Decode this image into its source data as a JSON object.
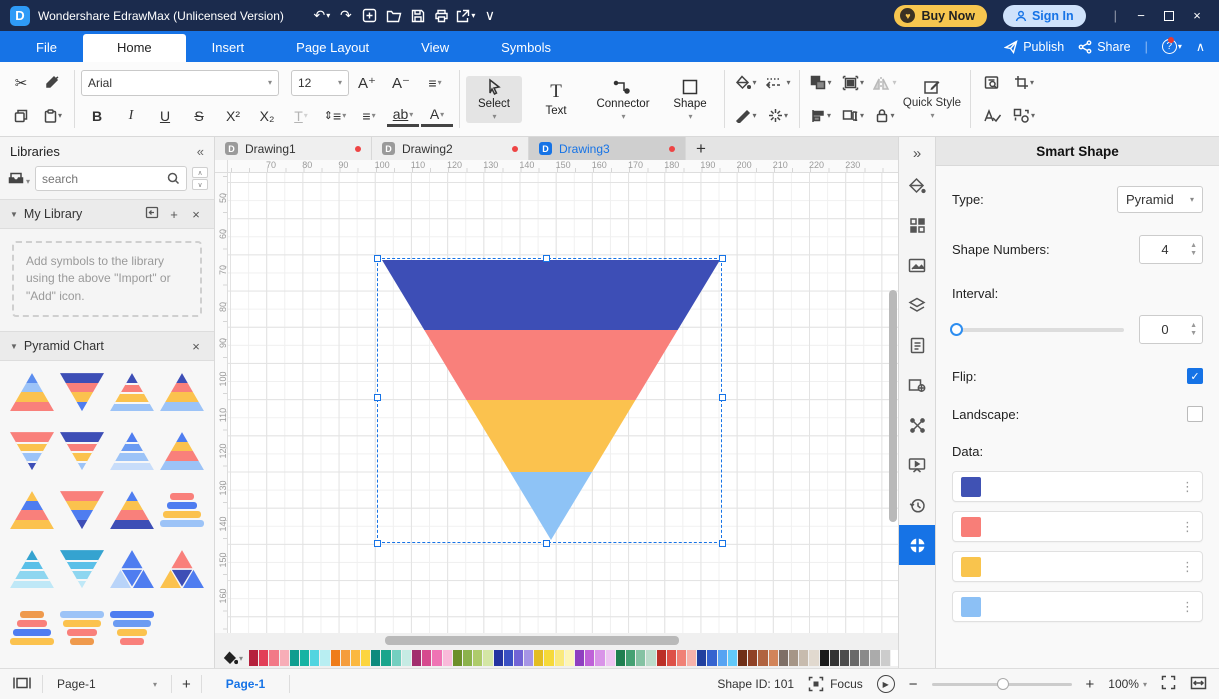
{
  "titlebar": {
    "app_title": "Wondershare EdrawMax (Unlicensed Version)",
    "buy_now": "Buy Now",
    "sign_in": "Sign In"
  },
  "menubar": {
    "items": [
      "File",
      "Home",
      "Insert",
      "Page Layout",
      "View",
      "Symbols"
    ],
    "active": "Home",
    "publish": "Publish",
    "share": "Share"
  },
  "ribbon": {
    "font_family": "Arial",
    "font_size": "12",
    "bold": "B",
    "italic": "I",
    "underline": "U",
    "strike": "S",
    "superscript": "X²",
    "subscript": "X₂",
    "text_style": "T",
    "highlight": "ab",
    "font_color": "A",
    "font_larger": "A⁺",
    "font_smaller": "A⁻",
    "select_label": "Select",
    "text_label": "Text",
    "connector_label": "Connector",
    "shape_label": "Shape",
    "quick_style_label": "Quick Style"
  },
  "left_panel": {
    "title": "Libraries",
    "search_placeholder": "search",
    "my_library": "My Library",
    "hint": "Add symbols to the library using the above \"Import\" or \"Add\" icon.",
    "pyramid_chart": "Pyramid Chart",
    "thumbs": [
      {
        "type": "u",
        "colors": [
          "#5b8def",
          "#9cc3f7",
          "#fbc24e",
          "#f9807b"
        ]
      },
      {
        "type": "d",
        "colors": [
          "#3d4eb6",
          "#f9807b",
          "#fbc24e",
          "#4f7df0"
        ]
      },
      {
        "type": "ug",
        "colors": [
          "#3d4eb6",
          "#f9807b",
          "#fbc24e",
          "#9cc3f7"
        ]
      },
      {
        "type": "u",
        "colors": [
          "#3d4eb6",
          "#f9807b",
          "#fbc24e",
          "#9cc3f7"
        ]
      },
      {
        "type": "dg",
        "colors": [
          "#f9807b",
          "#fbc24e",
          "#9cc3f7",
          "#3d4eb6"
        ]
      },
      {
        "type": "dg",
        "colors": [
          "#3d4eb6",
          "#f9807b",
          "#fbc24e",
          "#9cc3f7"
        ]
      },
      {
        "type": "ug",
        "colors": [
          "#4f7df0",
          "#6b9bf2",
          "#9cc3f7",
          "#c8ddfa"
        ]
      },
      {
        "type": "u",
        "colors": [
          "#4f7df0",
          "#fbc24e",
          "#f9807b",
          "#9cc3f7"
        ]
      },
      {
        "type": "u",
        "colors": [
          "#fbc24e",
          "#4f7df0",
          "#f9807b",
          "#fbc24e"
        ]
      },
      {
        "type": "d",
        "colors": [
          "#f9807b",
          "#fbc24e",
          "#4f7df0",
          "#3d4eb6"
        ]
      },
      {
        "type": "u",
        "colors": [
          "#4f7df0",
          "#fbc24e",
          "#f9807b",
          "#3d4eb6"
        ]
      },
      {
        "type": "s",
        "colors": [
          "#f9807b",
          "#4f7df0",
          "#fbc24e",
          "#9cc3f7"
        ]
      },
      {
        "type": "ug",
        "colors": [
          "#35a3d0",
          "#5bc0e8",
          "#8ed6f0",
          "#bfe8f7"
        ]
      },
      {
        "type": "dg",
        "colors": [
          "#35a3d0",
          "#5bc0e8",
          "#8ed6f0",
          "#bfe8f7"
        ]
      },
      {
        "type": "t4",
        "colors": [
          "#4f7df0",
          "#b9d4f9",
          "#4f7df0",
          "#4f7df0"
        ]
      },
      {
        "type": "t4",
        "colors": [
          "#f9807b",
          "#fbc24e",
          "#3d4eb6",
          "#4f7df0"
        ]
      },
      {
        "type": "s",
        "colors": [
          "#ef9a4d",
          "#f9807b",
          "#4f7df0",
          "#fbc24e"
        ]
      },
      {
        "type": "sd",
        "colors": [
          "#9cc3f7",
          "#fbc24e",
          "#f9807b",
          "#ef9a4d"
        ]
      },
      {
        "type": "sd",
        "colors": [
          "#4f7df0",
          "#6b9bf2",
          "#fbc24e",
          "#f9807b"
        ]
      }
    ]
  },
  "canvas": {
    "tabs": [
      "Drawing1",
      "Drawing2",
      "Drawing3"
    ],
    "active_tab": "Drawing3",
    "h_ruler": [
      "70",
      "80",
      "90",
      "100",
      "110",
      "120",
      "130",
      "140",
      "150",
      "160",
      "170",
      "180",
      "190",
      "200",
      "210",
      "220",
      "230"
    ],
    "v_ruler": [
      "50",
      "60",
      "70",
      "80",
      "90",
      "100",
      "110",
      "120",
      "130",
      "140",
      "150",
      "160"
    ],
    "pyramid_colors": [
      "#3D4EB6",
      "#F9807B",
      "#FBC24E",
      "#8EC3F6"
    ]
  },
  "right_panel": {
    "title": "Smart Shape",
    "type_label": "Type:",
    "type_value": "Pyramid",
    "shape_numbers_label": "Shape Numbers:",
    "shape_numbers_value": "4",
    "interval_label": "Interval:",
    "interval_value": "0",
    "flip_label": "Flip:",
    "flip_checked": true,
    "landscape_label": "Landscape:",
    "landscape_checked": false,
    "data_label": "Data:",
    "data_colors": [
      "#4052B4",
      "#F87E78",
      "#F9C44D",
      "#8CC0F5"
    ]
  },
  "palette": {
    "colors": [
      "#b5203c",
      "#e23e57",
      "#f27987",
      "#f7adb7",
      "#0f9d8f",
      "#16b3a3",
      "#52d5e0",
      "#b8eef2",
      "#ef7c1a",
      "#f59d3d",
      "#fbb840",
      "#fcd53f",
      "#0d8a7d",
      "#1aa58c",
      "#74cfc0",
      "#c6ebe4",
      "#a22e6e",
      "#d64a8e",
      "#ef74b4",
      "#f9bada",
      "#6d8f2a",
      "#8cb24c",
      "#aecb6b",
      "#d4e6a5",
      "#2433a0",
      "#3a50c3",
      "#7264d6",
      "#a695e6",
      "#e3bd22",
      "#f6d93a",
      "#fae97d",
      "#fdf5b8",
      "#8f3fc0",
      "#bf62d8",
      "#d994e8",
      "#eec5f2",
      "#1f7f50",
      "#45a173",
      "#85c2a3",
      "#bcdccb",
      "#bb2f27",
      "#dd5148",
      "#f08176",
      "#f7b3ab",
      "#21409f",
      "#3563cf",
      "#57a3f2",
      "#62c9f9",
      "#6f2f17",
      "#8f4126",
      "#b06340",
      "#d28459",
      "#7e6f66",
      "#a69687",
      "#c7bbae",
      "#e1d9cf",
      "#1a1a1a",
      "#333333",
      "#4d4d4d",
      "#696969",
      "#8a8a8a",
      "#ababab",
      "#cccccc",
      "#ffffff"
    ]
  },
  "statusbar": {
    "page_select": "Page-1",
    "page_tab": "Page-1",
    "shape_id": "Shape ID: 101",
    "focus_label": "Focus",
    "zoom_value": "100%"
  },
  "icons": {
    "undo": "↶",
    "redo": "↷",
    "dropdown": "▾",
    "collapse_left": "«",
    "expand_right": "»",
    "up": "∧",
    "down": "∨",
    "tri_down": "▼",
    "close": "×",
    "plus": "+",
    "minus": "−",
    "check": "✓",
    "kebab": "⋮",
    "menu": "≡",
    "spin_up": "▲",
    "spin_down": "▼",
    "cut": "✂",
    "heart": "♥",
    "divider": "|",
    "play": "▶",
    "import": "⊕"
  }
}
